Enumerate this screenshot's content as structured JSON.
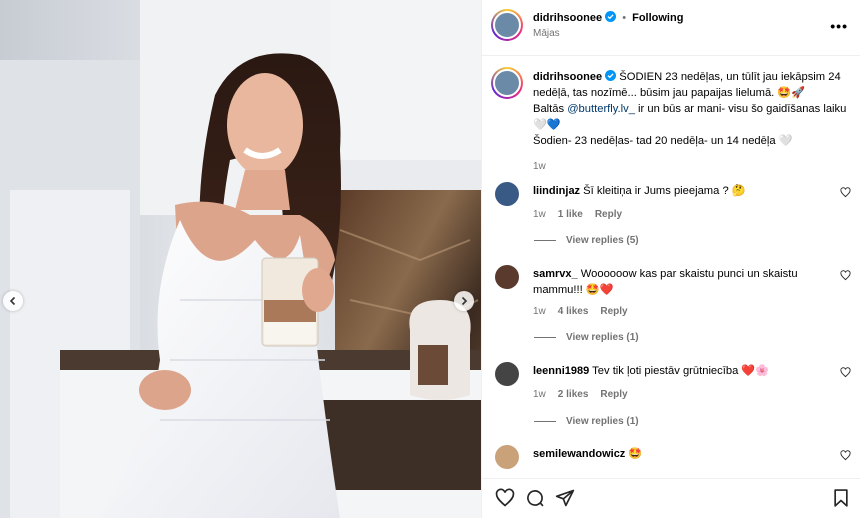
{
  "post": {
    "username": "didrihsoonee",
    "separator": "•",
    "follow_status": "Following",
    "location": "Mājas",
    "caption": {
      "line1": "ŠODIEN 23 nedēļas, un tūlīt jau iekāpsim 24 nedēļā, tas nozīmē... būsim jau papaijas lielumā. 🤩🚀",
      "line2_prefix": "Baltās ",
      "mention": "@butterfly.lv_",
      "line2_suffix": " ir un būs ar mani- visu šo gaidīšanas laiku 🤍💙",
      "line3": "Šodien- 23 nedēļas- tad 20 nedēļa- un 14 nedēļa 🤍",
      "time": "1w"
    },
    "more_label": "•••"
  },
  "comments": [
    {
      "username": "liindinjaz",
      "text": "Šī kleitiņa ir Jums pieejama ? 🤔",
      "time": "1w",
      "likes": "1 like",
      "reply": "Reply",
      "view_replies": "View replies (5)"
    },
    {
      "username": "samrvx_",
      "text": "Woooooow kas par skaistu punci un skaistu mammu!!! 🤩❤️",
      "time": "1w",
      "likes": "4 likes",
      "reply": "Reply",
      "view_replies": "View replies (1)"
    },
    {
      "username": "leenni1989",
      "text": "Tev tik ļoti piestāv grūtniecība ❤️🌸",
      "time": "1w",
      "likes": "2 likes",
      "reply": "Reply",
      "view_replies": "View replies (1)"
    },
    {
      "username": "semilewandowicz",
      "text": "🤩"
    }
  ],
  "icons": {
    "like": "heart-icon",
    "comment": "comment-icon",
    "share": "send-icon",
    "save": "bookmark-icon",
    "verified": "verified-badge-icon",
    "prev": "chevron-left-icon",
    "next": "chevron-right-icon"
  },
  "colors": {
    "verified": "#0095f6",
    "link": "#00376b",
    "muted": "#737373"
  }
}
